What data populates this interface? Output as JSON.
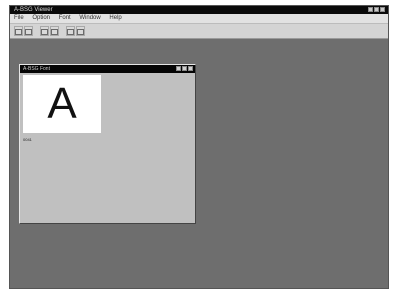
{
  "window": {
    "title": "A-BSG Viewer",
    "menu": [
      "File",
      "Option",
      "Font",
      "Window",
      "Help"
    ]
  },
  "toolbar": {
    "tools": [
      "open-icon",
      "save-icon",
      "font-icon",
      "zoom-in-icon",
      "zoom-out-icon",
      "help-icon"
    ]
  },
  "child_window": {
    "title": "A-BSG Font",
    "preview_glyph": "A",
    "caption": "0041"
  }
}
